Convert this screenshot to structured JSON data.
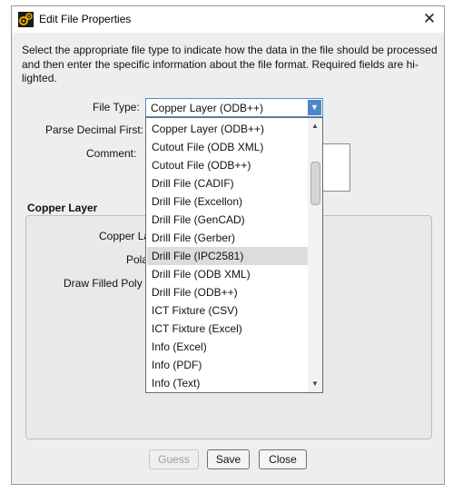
{
  "window": {
    "title": "Edit File Properties",
    "icon": "app-gear-icon",
    "close_glyph": "✕"
  },
  "instructions": "Select the appropriate file type to indicate how the data in the file should be processed and then enter the specific information about the file format. Required fields are hi-lighted.",
  "form": {
    "file_type_label": "File Type:",
    "file_type_value": "Copper Layer (ODB++)",
    "parse_decimal_label": "Parse Decimal First:",
    "comment_label": "Comment:"
  },
  "section": {
    "title": "Copper Layer",
    "copper_layer_label_partial": "Copper La",
    "polarity_label_partial": "Pola",
    "draw_filled_label_partial": "Draw Filled Poly I"
  },
  "dropdown": {
    "items": [
      "Copper Layer (ODB++)",
      "Cutout File (ODB XML)",
      "Cutout File (ODB++)",
      "Drill File (CADIF)",
      "Drill File (Excellon)",
      "Drill File (GenCAD)",
      "Drill File (Gerber)",
      "Drill File (IPC2581)",
      "Drill File (ODB XML)",
      "Drill File (ODB++)",
      "ICT Fixture (CSV)",
      "ICT Fixture (Excel)",
      "Info (Excel)",
      "Info (PDF)",
      "Info (Text)"
    ],
    "highlighted": "Drill File (IPC2581)",
    "scroll_up_glyph": "▲",
    "scroll_down_glyph": "▼",
    "combo_arrow_glyph": "▼"
  },
  "buttons": {
    "guess": "Guess",
    "save": "Save",
    "close": "Close"
  }
}
